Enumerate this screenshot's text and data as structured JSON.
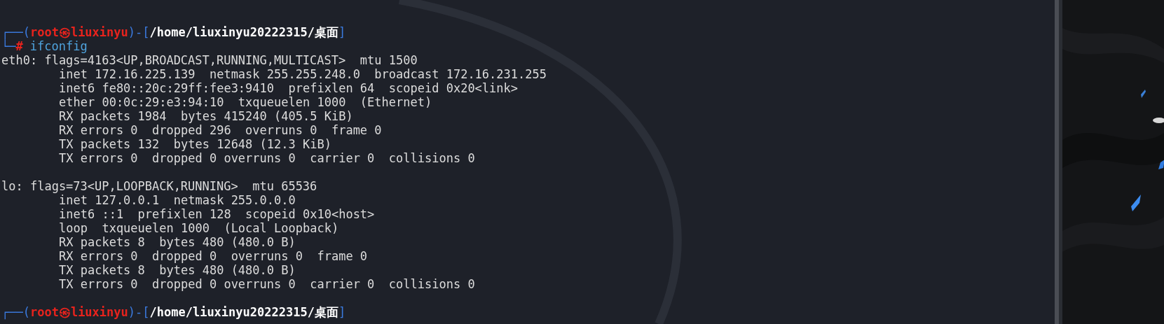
{
  "prompts": [
    {
      "frame_top": "┌──(",
      "user": "root㉿liuxinyu",
      "mid": ")-[",
      "cwd": "/home/liuxinyu20222315/桌面",
      "close": "]",
      "frame_bottom": "└─",
      "symbol": "#",
      "command": "ifconfig"
    }
  ],
  "interfaces": [
    {
      "header": "eth0: flags=4163<UP,BROADCAST,RUNNING,MULTICAST>  mtu 1500",
      "details": [
        "inet 172.16.225.139  netmask 255.255.248.0  broadcast 172.16.231.255",
        "inet6 fe80::20c:29ff:fee3:9410  prefixlen 64  scopeid 0x20<link>",
        "ether 00:0c:29:e3:94:10  txqueuelen 1000  (Ethernet)",
        "RX packets 1984  bytes 415240 (405.5 KiB)",
        "RX errors 0  dropped 296  overruns 0  frame 0",
        "TX packets 132  bytes 12648 (12.3 KiB)",
        "TX errors 0  dropped 0 overruns 0  carrier 0  collisions 0"
      ]
    },
    {
      "header": "lo: flags=73<UP,LOOPBACK,RUNNING>  mtu 65536",
      "details": [
        "inet 127.0.0.1  netmask 255.0.0.0",
        "inet6 ::1  prefixlen 128  scopeid 0x10<host>",
        "loop  txqueuelen 1000  (Local Loopback)",
        "RX packets 8  bytes 480 (480.0 B)",
        "RX errors 0  dropped 0  overruns 0  frame 0",
        "TX packets 8  bytes 480 (480.0 B)",
        "TX errors 0  dropped 0 overruns 0  carrier 0  collisions 0"
      ]
    }
  ],
  "next_prompt": {
    "frame_top": "┌──(",
    "user": "root㉿liuxinyu",
    "mid": ")-[",
    "cwd": "/home/liuxinyu20222315/桌面",
    "close": "]"
  }
}
